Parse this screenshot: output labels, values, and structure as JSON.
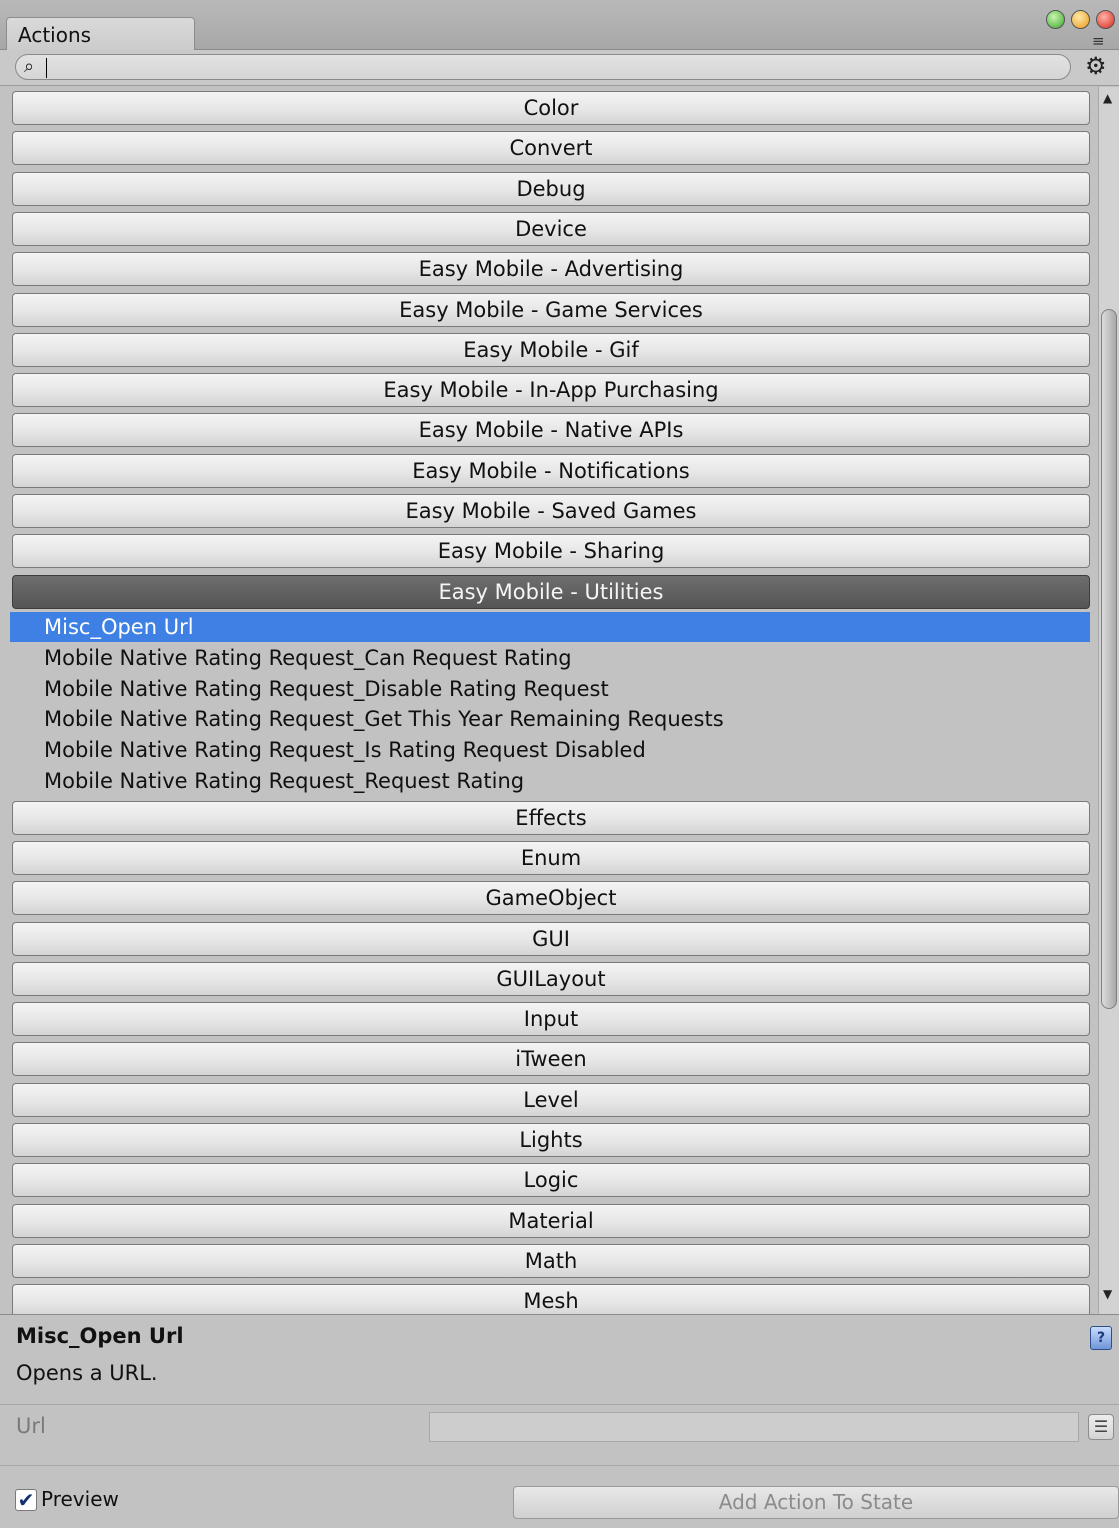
{
  "window": {
    "tab_title": "Actions",
    "menu_icon": "≡",
    "search": {
      "value": "",
      "icon": "search-icon"
    }
  },
  "categories_before": [
    "Color",
    "Convert",
    "Debug",
    "Device",
    "Easy Mobile - Advertising",
    "Easy Mobile - Game Services",
    "Easy Mobile - Gif",
    "Easy Mobile - In-App Purchasing",
    "Easy Mobile - Native APIs",
    "Easy Mobile - Notifications",
    "Easy Mobile - Saved Games",
    "Easy Mobile - Sharing"
  ],
  "selected_category": "Easy Mobile - Utilities",
  "actions": [
    "Misc_Open Url",
    "Mobile Native Rating Request_Can Request Rating",
    "Mobile Native Rating Request_Disable Rating Request",
    "Mobile Native Rating Request_Get This Year Remaining Requests",
    "Mobile Native Rating Request_Is Rating Request Disabled",
    "Mobile Native Rating Request_Request Rating"
  ],
  "highlighted_action_index": 0,
  "categories_after": [
    "Effects",
    "Enum",
    "GameObject",
    "GUI",
    "GUILayout",
    "Input",
    "iTween",
    "Level",
    "Lights",
    "Logic",
    "Material",
    "Math",
    "Mesh"
  ],
  "detail": {
    "title": "Misc_Open Url",
    "description": "Opens a URL.",
    "url_label": "Url",
    "url_value": "",
    "preview_label": "Preview",
    "preview_checked": true,
    "add_button": "Add Action To State"
  },
  "colors": {
    "selection_blue": "#3e80e4",
    "selected_category": "#5f5f5f"
  }
}
